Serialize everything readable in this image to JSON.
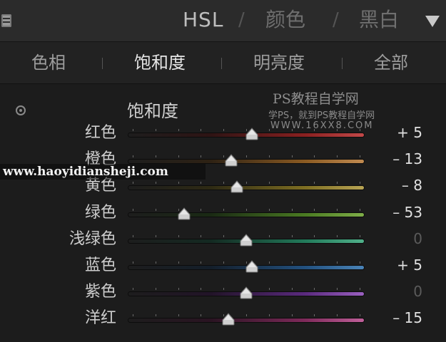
{
  "header": {
    "modes": [
      "HSL",
      "颜色",
      "黑白"
    ],
    "separator": "/"
  },
  "tabs": [
    "色相",
    "饱和度",
    "明亮度",
    "全部"
  ],
  "section_title": "饱和度",
  "watermarks": {
    "line1": "PS教程自学网",
    "line2": "学PS，就到PS教程自学网",
    "line3": "WWW.16XX8.COM",
    "url": "www.haoyidiansheji.com"
  },
  "rows": [
    {
      "label": "红色",
      "value_text": "+ 5",
      "value": 5,
      "colors": [
        "#2e1414",
        "#8a2020",
        "#c24848"
      ]
    },
    {
      "label": "橙色",
      "value_text": "– 13",
      "value": -13,
      "colors": [
        "#2e2214",
        "#8a5a22",
        "#c08a50"
      ]
    },
    {
      "label": "黄色",
      "value_text": "– 8",
      "value": -8,
      "colors": [
        "#2e2a14",
        "#7e6e22",
        "#b8a454"
      ]
    },
    {
      "label": "绿色",
      "value_text": "– 53",
      "value": -53,
      "colors": [
        "#1a2a14",
        "#4a7a22",
        "#7fae48"
      ]
    },
    {
      "label": "浅绿色",
      "value_text": "0",
      "value": 0,
      "colors": [
        "#142a22",
        "#227a5a",
        "#50b08a"
      ]
    },
    {
      "label": "蓝色",
      "value_text": "+ 5",
      "value": 5,
      "colors": [
        "#141e2a",
        "#22507e",
        "#4a84b8"
      ]
    },
    {
      "label": "紫色",
      "value_text": "0",
      "value": 0,
      "colors": [
        "#221428",
        "#5a2a7e",
        "#9a60c0"
      ]
    },
    {
      "label": "洋红",
      "value_text": "– 15",
      "value": -15,
      "colors": [
        "#2a1422",
        "#7e2a5a",
        "#c0609a"
      ]
    }
  ],
  "slider_range": [
    -100,
    100
  ]
}
